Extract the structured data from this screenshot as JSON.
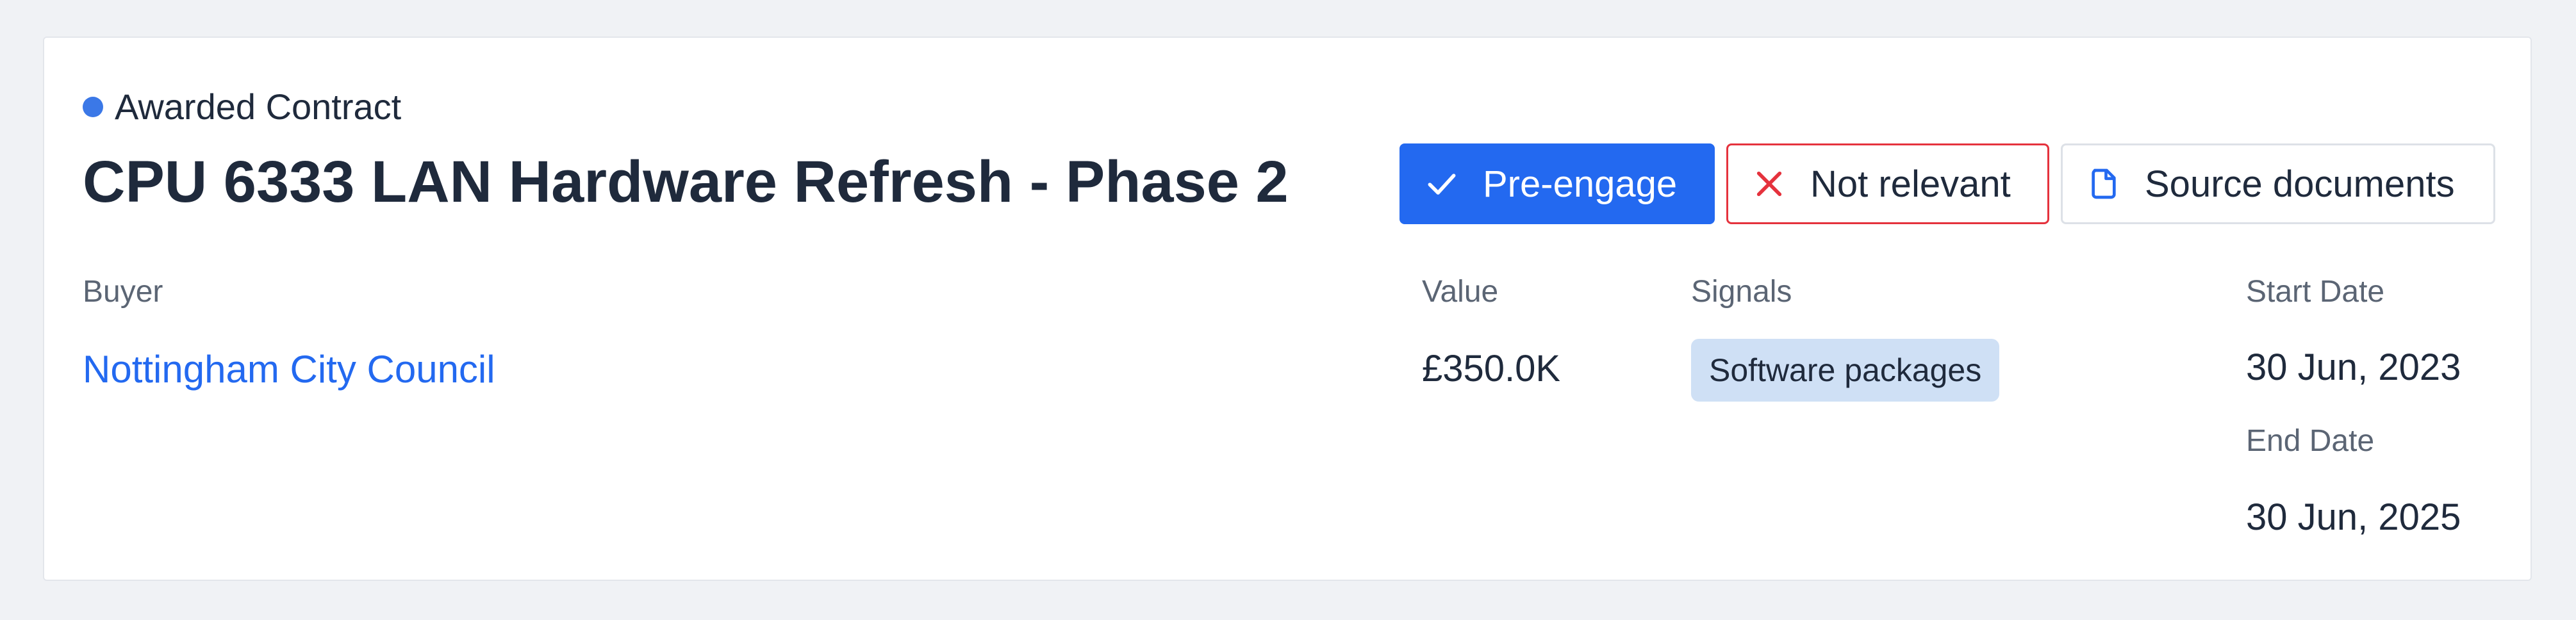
{
  "card": {
    "status_label": "Awarded Contract",
    "title": "CPU 6333 LAN Hardware Refresh - Phase 2",
    "actions": {
      "pre_engage": "Pre-engage",
      "not_relevant": "Not relevant",
      "source_documents": "Source documents"
    },
    "buyer": {
      "label": "Buyer",
      "name": "Nottingham City Council"
    },
    "value": {
      "label": "Value",
      "amount": "£350.0K"
    },
    "signals": {
      "label": "Signals",
      "tags": [
        "Software packages"
      ]
    },
    "dates": {
      "start_label": "Start Date",
      "start": "30 Jun, 2023",
      "end_label": "End Date",
      "end": "30 Jun, 2025"
    }
  },
  "colors": {
    "accent": "#2369f0",
    "status_dot": "#3b78e7",
    "danger": "#e5323d",
    "tag_bg": "#cfe0f5",
    "page_bg": "#f0f2f5"
  },
  "icons": {
    "status": "status-dot",
    "pre_engage": "check-icon",
    "not_relevant": "x-icon",
    "source_documents": "document-icon"
  }
}
